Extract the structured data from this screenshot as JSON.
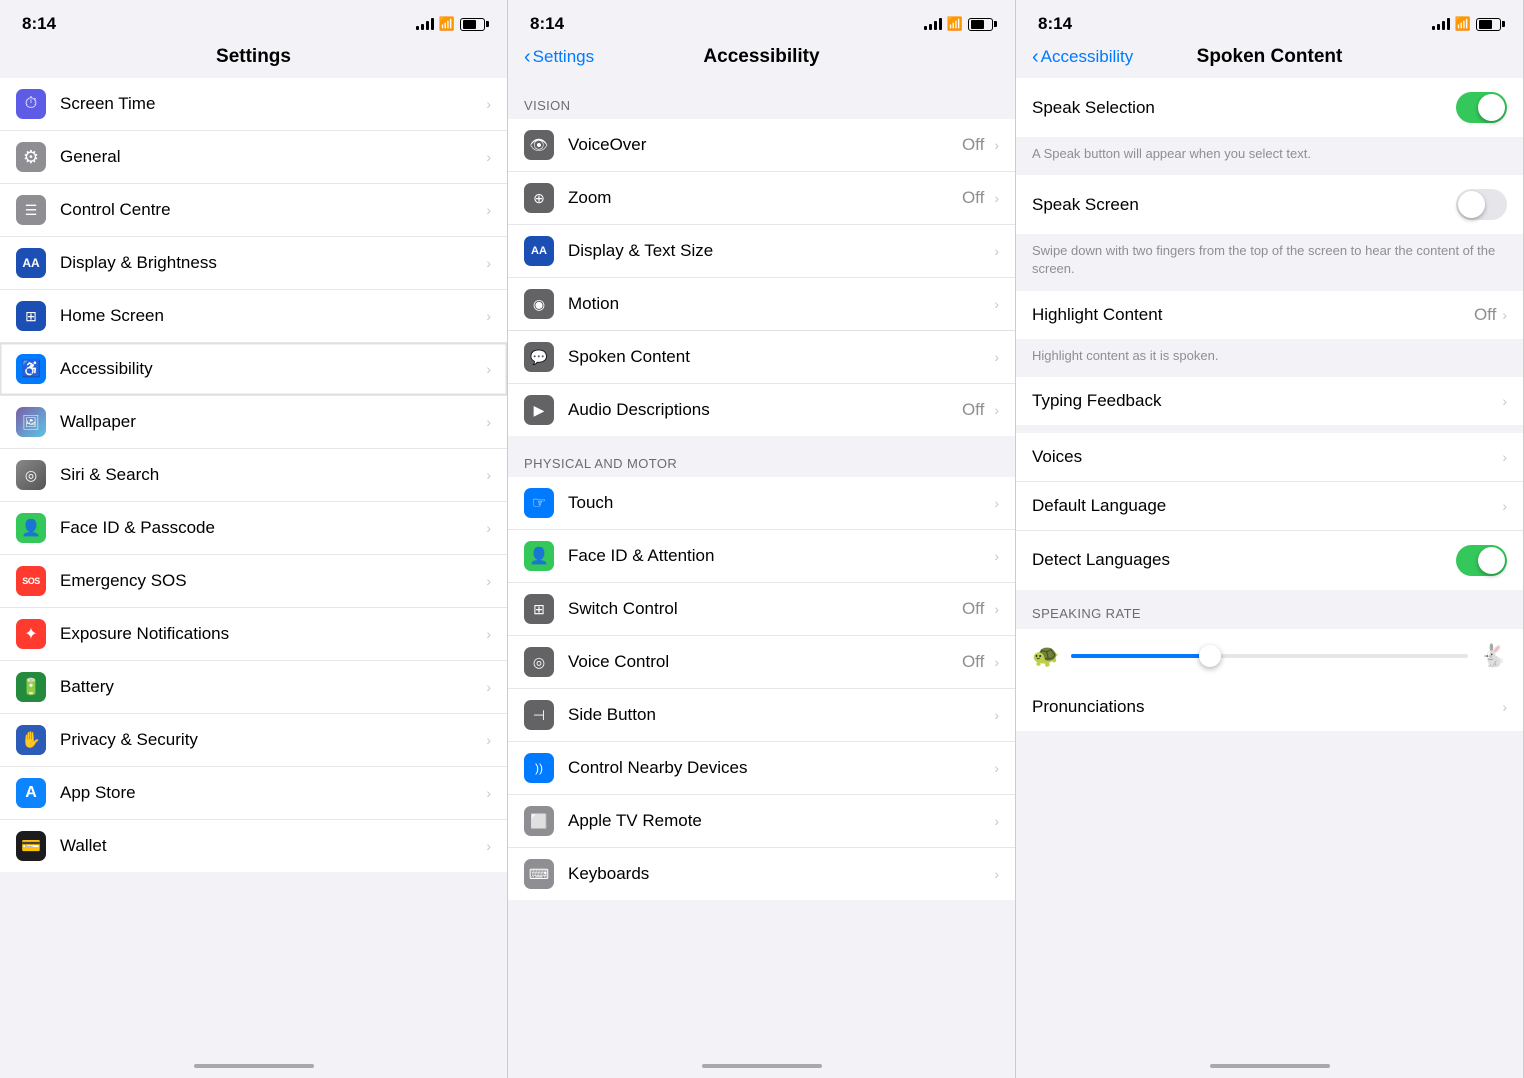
{
  "panels": [
    {
      "id": "panel1",
      "status": {
        "time": "8:14",
        "signal": 4,
        "wifi": true,
        "battery": 70
      },
      "header": {
        "title": "Settings",
        "backLabel": null
      },
      "items": [
        {
          "id": "screen-time",
          "label": "Screen Time",
          "icon": "⏱",
          "iconBg": "purple",
          "value": "",
          "hasChevron": true
        },
        {
          "id": "general",
          "label": "General",
          "icon": "⚙",
          "iconBg": "gray",
          "value": "",
          "hasChevron": true
        },
        {
          "id": "control-centre",
          "label": "Control Centre",
          "icon": "☰",
          "iconBg": "gray",
          "value": "",
          "hasChevron": true
        },
        {
          "id": "display-brightness",
          "label": "Display & Brightness",
          "icon": "AA",
          "iconBg": "blue-dark",
          "value": "",
          "hasChevron": true
        },
        {
          "id": "home-screen",
          "label": "Home Screen",
          "icon": "⊞",
          "iconBg": "blue-dark",
          "value": "",
          "hasChevron": true
        },
        {
          "id": "accessibility",
          "label": "Accessibility",
          "icon": "♿",
          "iconBg": "blue",
          "value": "",
          "hasChevron": true,
          "selected": true
        },
        {
          "id": "wallpaper",
          "label": "Wallpaper",
          "icon": "🖼",
          "iconBg": "teal",
          "value": "",
          "hasChevron": true
        },
        {
          "id": "siri-search",
          "label": "Siri & Search",
          "icon": "◎",
          "iconBg": "dark-gray",
          "value": "",
          "hasChevron": true
        },
        {
          "id": "face-id",
          "label": "Face ID & Passcode",
          "icon": "👤",
          "iconBg": "green",
          "value": "",
          "hasChevron": true
        },
        {
          "id": "emergency-sos",
          "label": "Emergency SOS",
          "icon": "SOS",
          "iconBg": "red",
          "value": "",
          "hasChevron": true
        },
        {
          "id": "exposure",
          "label": "Exposure Notifications",
          "icon": "✦",
          "iconBg": "red",
          "value": "",
          "hasChevron": true
        },
        {
          "id": "battery",
          "label": "Battery",
          "icon": "🔋",
          "iconBg": "dark-green",
          "value": "",
          "hasChevron": true
        },
        {
          "id": "privacy-security",
          "label": "Privacy & Security",
          "icon": "✋",
          "iconBg": "dark-blue",
          "value": "",
          "hasChevron": true
        },
        {
          "id": "app-store",
          "label": "App Store",
          "icon": "A",
          "iconBg": "app-store-blue",
          "value": "",
          "hasChevron": true
        },
        {
          "id": "wallet",
          "label": "Wallet",
          "icon": "💳",
          "iconBg": "black",
          "value": "",
          "hasChevron": true
        }
      ]
    },
    {
      "id": "panel2",
      "status": {
        "time": "8:14",
        "signal": 4,
        "wifi": true,
        "battery": 70
      },
      "header": {
        "title": "Accessibility",
        "backLabel": "Settings"
      },
      "sections": [
        {
          "header": "VISION",
          "items": [
            {
              "id": "voiceover",
              "label": "VoiceOver",
              "value": "Off",
              "hasChevron": true,
              "iconBg": "dark-gray",
              "icon": "👁"
            },
            {
              "id": "zoom",
              "label": "Zoom",
              "value": "Off",
              "hasChevron": true,
              "iconBg": "dark-gray",
              "icon": "⊕"
            },
            {
              "id": "display-text-size",
              "label": "Display & Text Size",
              "value": "",
              "hasChevron": true,
              "iconBg": "blue-dark",
              "icon": "AA"
            },
            {
              "id": "motion",
              "label": "Motion",
              "value": "",
              "hasChevron": true,
              "iconBg": "dark-gray",
              "icon": "◉"
            },
            {
              "id": "spoken-content",
              "label": "Spoken Content",
              "value": "",
              "hasChevron": true,
              "iconBg": "dark-gray",
              "icon": "💬",
              "selected": true
            },
            {
              "id": "audio-descriptions",
              "label": "Audio Descriptions",
              "value": "Off",
              "hasChevron": true,
              "iconBg": "dark-gray",
              "icon": "▶"
            }
          ]
        },
        {
          "header": "PHYSICAL AND MOTOR",
          "items": [
            {
              "id": "touch",
              "label": "Touch",
              "value": "",
              "hasChevron": true,
              "iconBg": "blue",
              "icon": "☞"
            },
            {
              "id": "face-id-attention",
              "label": "Face ID & Attention",
              "value": "",
              "hasChevron": true,
              "iconBg": "green",
              "icon": "👤"
            },
            {
              "id": "switch-control",
              "label": "Switch Control",
              "value": "Off",
              "hasChevron": true,
              "iconBg": "dark-gray",
              "icon": "⊞"
            },
            {
              "id": "voice-control",
              "label": "Voice Control",
              "value": "Off",
              "hasChevron": true,
              "iconBg": "dark-gray",
              "icon": "◎"
            },
            {
              "id": "side-button",
              "label": "Side Button",
              "value": "",
              "hasChevron": true,
              "iconBg": "dark-gray",
              "icon": "⊣"
            },
            {
              "id": "control-nearby",
              "label": "Control Nearby Devices",
              "value": "",
              "hasChevron": true,
              "iconBg": "blue",
              "icon": "))))"
            },
            {
              "id": "apple-tv-remote",
              "label": "Apple TV Remote",
              "value": "",
              "hasChevron": true,
              "iconBg": "gray",
              "icon": "⬜"
            },
            {
              "id": "keyboards",
              "label": "Keyboards",
              "value": "",
              "hasChevron": true,
              "iconBg": "gray",
              "icon": "⌨"
            }
          ]
        }
      ]
    },
    {
      "id": "panel3",
      "status": {
        "time": "8:14",
        "signal": 4,
        "wifi": true,
        "battery": 70
      },
      "header": {
        "title": "Spoken Content",
        "backLabel": "Accessibility"
      },
      "items": [
        {
          "id": "speak-selection",
          "label": "Speak Selection",
          "toggle": true,
          "toggleOn": true,
          "description": "A Speak button will appear when you select text."
        },
        {
          "id": "speak-screen",
          "label": "Speak Screen",
          "toggle": true,
          "toggleOn": false,
          "description": "Swipe down with two fingers from the top of the screen to hear the content of the screen."
        },
        {
          "id": "highlight-content",
          "label": "Highlight Content",
          "value": "Off",
          "hasChevron": true,
          "description": "Highlight content as it is spoken."
        },
        {
          "id": "typing-feedback",
          "label": "Typing Feedback",
          "hasChevron": true
        },
        {
          "id": "voices",
          "label": "Voices",
          "hasChevron": true
        },
        {
          "id": "default-language",
          "label": "Default Language",
          "hasChevron": true
        },
        {
          "id": "detect-languages",
          "label": "Detect Languages",
          "toggle": true,
          "toggleOn": true
        }
      ],
      "speakingRate": {
        "label": "SPEAKING RATE",
        "value": 35
      },
      "bottomItems": [
        {
          "id": "pronunciations",
          "label": "Pronunciations",
          "hasChevron": true
        }
      ]
    }
  ]
}
